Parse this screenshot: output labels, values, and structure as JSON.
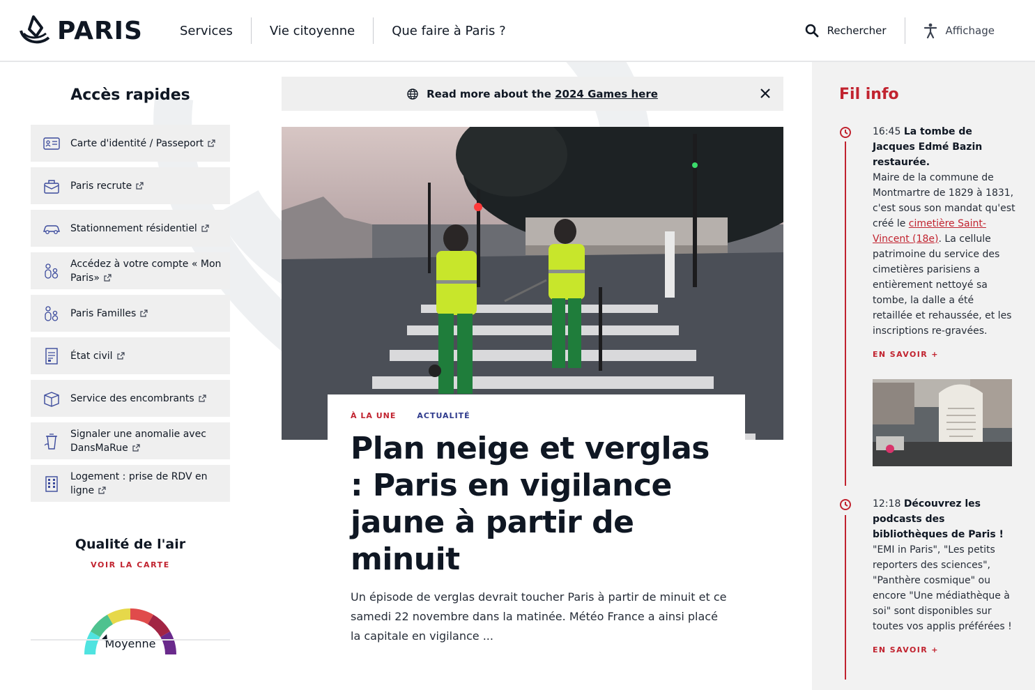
{
  "header": {
    "logo_text": "PARIS",
    "nav": [
      "Services",
      "Vie citoyenne",
      "Que faire à Paris ?"
    ],
    "search_label": "Rechercher",
    "display_label": "Affichage"
  },
  "quick_access": {
    "title": "Accès rapides",
    "items": [
      {
        "label": "Carte d'identité / Passeport",
        "icon": "id-card-icon"
      },
      {
        "label": "Paris recrute",
        "icon": "briefcase-icon"
      },
      {
        "label": "Stationnement résidentiel",
        "icon": "car-icon"
      },
      {
        "label": "Accédez à votre compte « Mon Paris»",
        "icon": "people-icon"
      },
      {
        "label": "Paris Familles",
        "icon": "family-icon"
      },
      {
        "label": "État civil",
        "icon": "document-icon"
      },
      {
        "label": "Service des encombrants",
        "icon": "box-icon"
      },
      {
        "label": "Signaler une anomalie avec DansMaRue",
        "icon": "trash-icon"
      },
      {
        "label": "Logement : prise de RDV en ligne",
        "icon": "building-icon"
      }
    ]
  },
  "air_quality": {
    "title": "Qualité de l'air",
    "link": "VOIR LA CARTE",
    "level": "Moyenne",
    "level_index": 2,
    "colors": [
      "#4fe3e0",
      "#4ec28f",
      "#e6d84a",
      "#e04b4b",
      "#a22544",
      "#6a2a8c"
    ]
  },
  "banner": {
    "prefix": "Read more about the ",
    "link": "2024 Games here"
  },
  "hero": {
    "tag1": "À LA UNE",
    "tag2": "ACTUALITÉ",
    "title": "Plan neige et verglas : Paris en vigilance jaune à partir de minuit",
    "lead": "Un épisode de verglas devrait toucher Paris à partir de minuit et ce samedi 22 novembre dans la matinée. Météo France a ainsi placé la capitale en vigilance ..."
  },
  "fil_info": {
    "title": "Fil info",
    "items": [
      {
        "time": "16:45",
        "title": "La tombe de Jacques Edmé Bazin restaurée.",
        "text_before": "Maire de la commune de Montmartre de 1829 à 1831, c'est sous son mandat qu'est créé le ",
        "link": "cimetière Saint-Vincent (18e)",
        "text_after": ". La cellule patrimoine du service des cimetières parisiens a entièrement nettoyé sa tombe, la dalle a été retaillée et rehaussée, et les inscriptions re-gravées.",
        "more": "EN SAVOIR +"
      },
      {
        "time": "12:18",
        "title": "Découvrez les podcasts des bibliothèques de Paris !",
        "text": "\"EMI in Paris\", \"Les petits reporters des sciences\", \"Panthère cosmique\" ou encore \"Une médiathèque à soi\" sont disponibles sur toutes vos applis préférées !",
        "more": "EN SAVOIR +"
      }
    ]
  },
  "colors": {
    "accent_red": "#c1232f",
    "navy": "#2e3a8c",
    "text": "#0f1723",
    "panel": "#efefef"
  }
}
